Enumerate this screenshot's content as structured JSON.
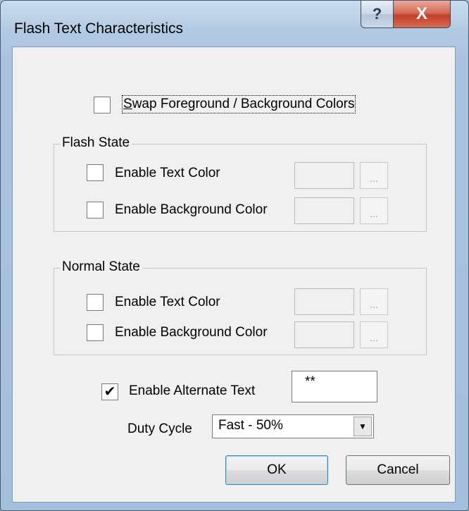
{
  "window": {
    "title": "Flash Text Characteristics",
    "help_glyph": "?",
    "close_glyph": "X"
  },
  "swap": {
    "checked": false,
    "label_first": "S",
    "label_rest": "wap Foreground / Background Colors"
  },
  "flash_state": {
    "title": "Flash State",
    "text_color": {
      "label": "Enable Text Color",
      "checked": false,
      "button": "..."
    },
    "bg_color": {
      "label": "Enable Background Color",
      "checked": false,
      "button": "..."
    }
  },
  "normal_state": {
    "title": "Normal State",
    "text_color": {
      "label": "Enable Text Color",
      "checked": false,
      "button": "..."
    },
    "bg_color": {
      "label": "Enable Background Color",
      "checked": false,
      "button": "..."
    }
  },
  "alternate_text": {
    "label": "Enable Alternate Text",
    "checked": true,
    "check_glyph": "✔",
    "value": "**"
  },
  "duty_cycle": {
    "label": "Duty Cycle",
    "value": "Fast - 50%",
    "arrow_glyph": "▼"
  },
  "buttons": {
    "ok": "OK",
    "cancel": "Cancel"
  }
}
